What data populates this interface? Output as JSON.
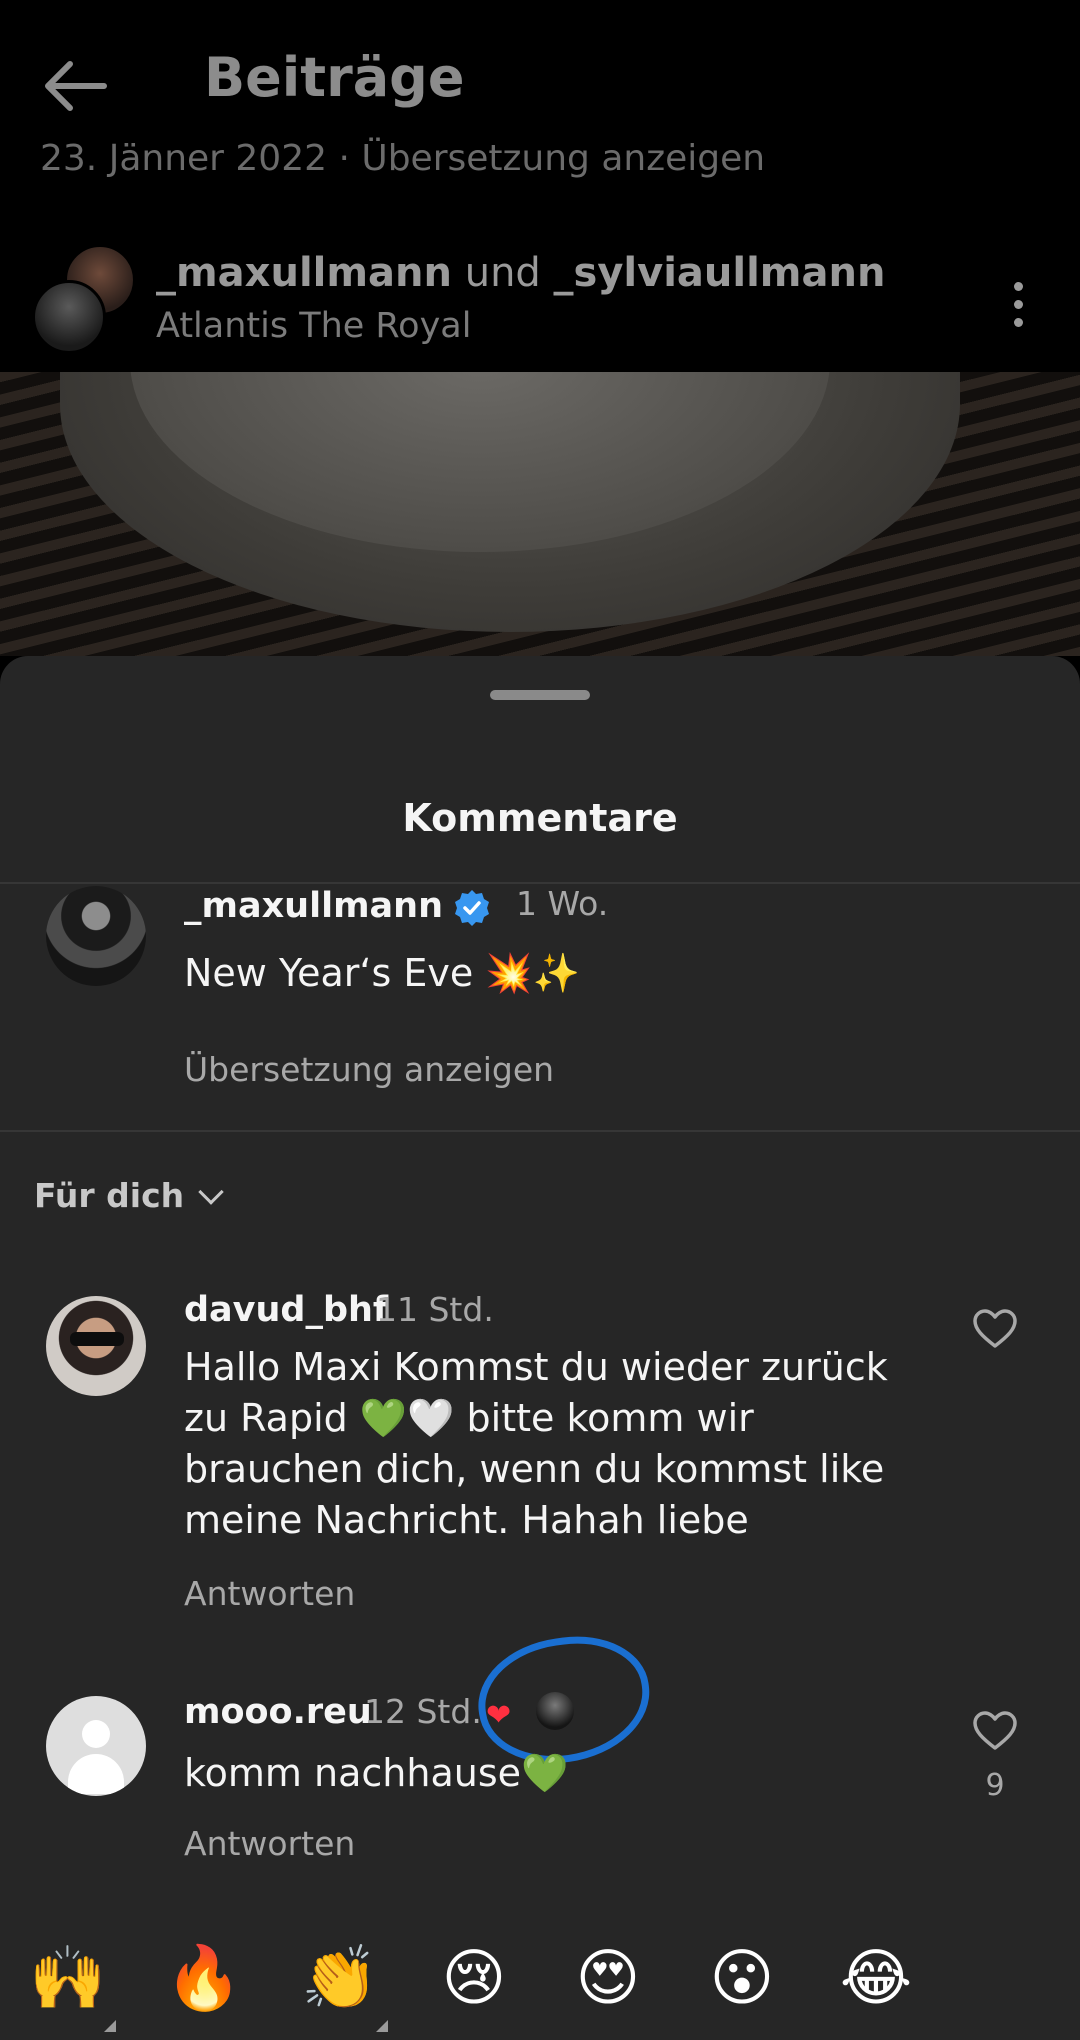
{
  "header": {
    "title": "Beiträge",
    "prev_caption": "23. Jänner 2022 · Übersetzung anzeigen"
  },
  "post": {
    "user_primary": "_maxullmann",
    "joiner": " und ",
    "user_secondary": "_sylviaullmann",
    "location": "Atlantis The Royal"
  },
  "comments_sheet": {
    "title": "Kommentare",
    "caption": {
      "user": "_maxullmann",
      "time": "1 Wo.",
      "text": "New Year‘s Eve 💥✨",
      "translate": "Übersetzung anzeigen"
    },
    "filter": "Für dich",
    "comments": [
      {
        "user": "davud_bhf",
        "time": "11 Std.",
        "text": "Hallo Maxi Kommst du wieder zurück zu Rapid 💚🤍 bitte komm wir brauchen dich, wenn du kommst like meine Nachricht. Hahah liebe",
        "reply": "Antworten",
        "likes": ""
      },
      {
        "user": "mooo.reu",
        "time": "12 Std.",
        "liked_by_author": "❤",
        "text": "komm nachhause💚",
        "reply": "Antworten",
        "likes": "9"
      }
    ],
    "quick_reactions": [
      "🙌",
      "🔥",
      "👏",
      "😢",
      "😍",
      "😮",
      "😂"
    ]
  }
}
